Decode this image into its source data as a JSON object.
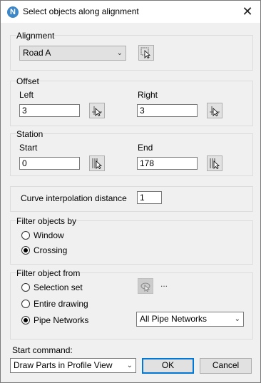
{
  "window": {
    "title": "Select objects along alignment",
    "app_icon_letter": "N",
    "close_glyph": "✕"
  },
  "alignment": {
    "group_label": "Alignment",
    "value": "Road A"
  },
  "offset": {
    "group_label": "Offset",
    "left_label": "Left",
    "left_value": "3",
    "right_label": "Right",
    "right_value": "3"
  },
  "station": {
    "group_label": "Station",
    "start_label": "Start",
    "start_value": "0",
    "end_label": "End",
    "end_value": "178"
  },
  "curve": {
    "label": "Curve interpolation distance",
    "value": "1"
  },
  "filter_by": {
    "group_label": "Filter objects by",
    "options": [
      "Window",
      "Crossing"
    ],
    "selected": "Crossing"
  },
  "filter_from": {
    "group_label": "Filter object from",
    "options": [
      "Selection set",
      "Entire drawing",
      "Pipe Networks"
    ],
    "selected": "Pipe Networks",
    "ellipsis": "...",
    "network_value": "All Pipe Networks"
  },
  "start_command": {
    "label": "Start command:",
    "value": "Draw Parts in Profile View"
  },
  "buttons": {
    "ok": "OK",
    "cancel": "Cancel"
  },
  "icons": {
    "pick": "pointer-pick-icon",
    "station_pick": "station-pick-icon",
    "lasso": "lasso-select-icon",
    "dropdown": "chevron-down-icon"
  }
}
